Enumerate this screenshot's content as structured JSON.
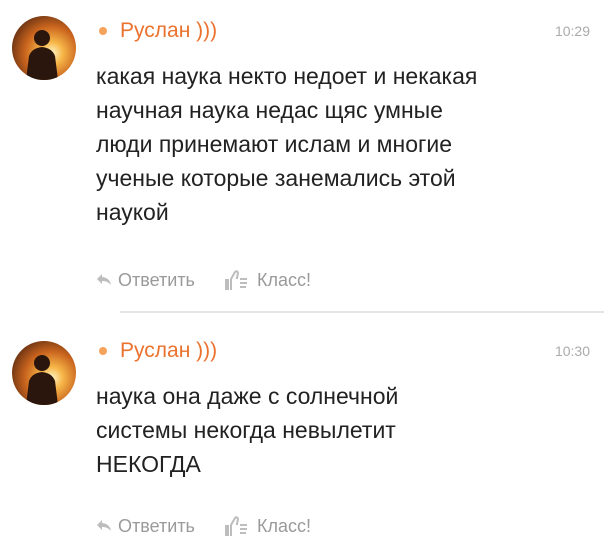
{
  "theme": {
    "author_color": "#eb722e",
    "presence_color": "#f5a25d",
    "muted_color": "#9a9a9a"
  },
  "comments": [
    {
      "author": "Руслан )))",
      "time": "10:29",
      "text": "какая наука  некто недоет и некакая\nнаучная наука недас щяс умные\nлюди принемают ислам и многие\nученые которые занемались этой\nнаукой",
      "reply_label": "Ответить",
      "like_label": "Класс!",
      "icons": [
        "avatar",
        "presence-dot",
        "reply-arrow-icon",
        "thumbs-up-icon"
      ]
    },
    {
      "author": "Руслан )))",
      "time": "10:30",
      "text": "наука она даже с солнечной\nсистемы некогда невылетит\nНЕКОГДА",
      "reply_label": "Ответить",
      "like_label": "Класс!",
      "icons": [
        "avatar",
        "presence-dot",
        "reply-arrow-icon",
        "thumbs-up-icon"
      ]
    }
  ]
}
